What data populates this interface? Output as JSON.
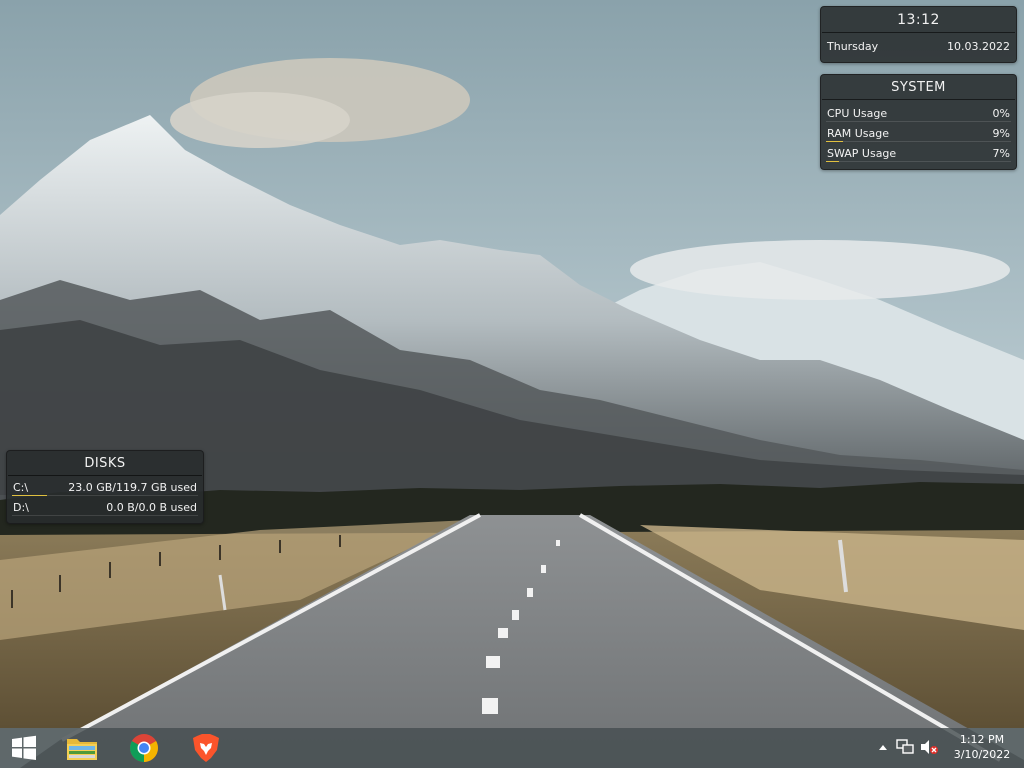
{
  "clock_widget": {
    "time": "13:12",
    "day": "Thursday",
    "date": "10.03.2022"
  },
  "system_widget": {
    "title": "SYSTEM",
    "rows": [
      {
        "label": "CPU Usage",
        "value": "0%",
        "percent": 0
      },
      {
        "label": "RAM Usage",
        "value": "9%",
        "percent": 9
      },
      {
        "label": "SWAP Usage",
        "value": "7%",
        "percent": 7
      }
    ]
  },
  "disks_widget": {
    "title": "DISKS",
    "rows": [
      {
        "label": "C:\\",
        "value": "23.0 GB/119.7 GB used",
        "percent": 19
      },
      {
        "label": "D:\\",
        "value": "0.0 B/0.0 B used",
        "percent": 0
      }
    ]
  },
  "taskbar": {
    "pinned": [
      {
        "name": "file-explorer",
        "icon": "folder-icon"
      },
      {
        "name": "chrome",
        "icon": "chrome-icon"
      },
      {
        "name": "brave",
        "icon": "brave-lion-icon"
      }
    ],
    "tray": {
      "time": "1:12 PM",
      "date": "3/10/2022"
    }
  },
  "colors": {
    "widget_bg": "#2c3032",
    "usage_bar": "#e0c040",
    "taskbar": "#464e50"
  }
}
